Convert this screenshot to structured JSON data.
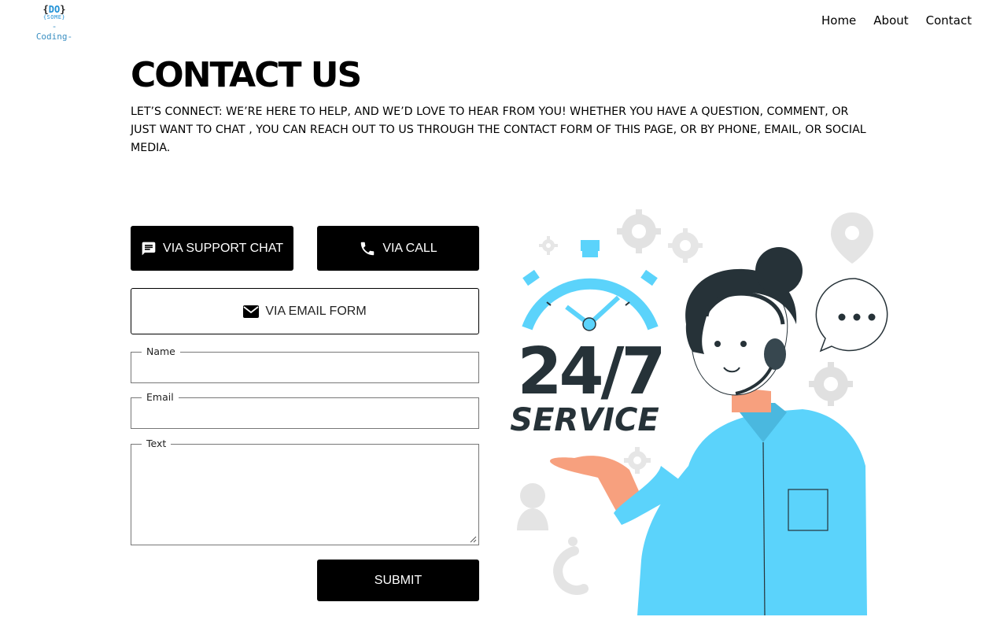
{
  "logo": {
    "line1_left": "{",
    "line1_mid": "DO",
    "line1_right": "}",
    "line2": "{SOME}",
    "line3": "-Coding-"
  },
  "nav": {
    "home": "Home",
    "about": "About",
    "contact": "Contact"
  },
  "page": {
    "title": "CONTACT US",
    "subtitle": "LET’S CONNECT: WE’RE HERE TO HELP, AND WE’D LOVE TO HEAR FROM YOU! WHETHER YOU HAVE A QUESTION, COMMENT, OR JUST WANT TO CHAT , YOU CAN REACH OUT TO US THROUGH THE CONTACT FORM OF THIS PAGE, OR BY PHONE, EMAIL, OR SOCIAL MEDIA."
  },
  "buttons": {
    "support_chat": "VIA SUPPORT CHAT",
    "call": "VIA CALL",
    "email_form": "VIA EMAIL FORM",
    "submit": "SUBMIT"
  },
  "form": {
    "name_label": "Name",
    "name_value": "",
    "email_label": "Email",
    "email_value": "",
    "text_label": "Text",
    "text_value": ""
  },
  "illustration": {
    "headline": "24/7",
    "subline": "SERVICE",
    "bubble": "...",
    "accent_color": "#5bd3fb",
    "dark_color": "#263238"
  },
  "icons": [
    "chat-icon",
    "phone-icon",
    "envelope-icon",
    "gear-icon",
    "location-pin-icon",
    "user-icon",
    "question-mark-icon",
    "stopwatch-icon"
  ]
}
